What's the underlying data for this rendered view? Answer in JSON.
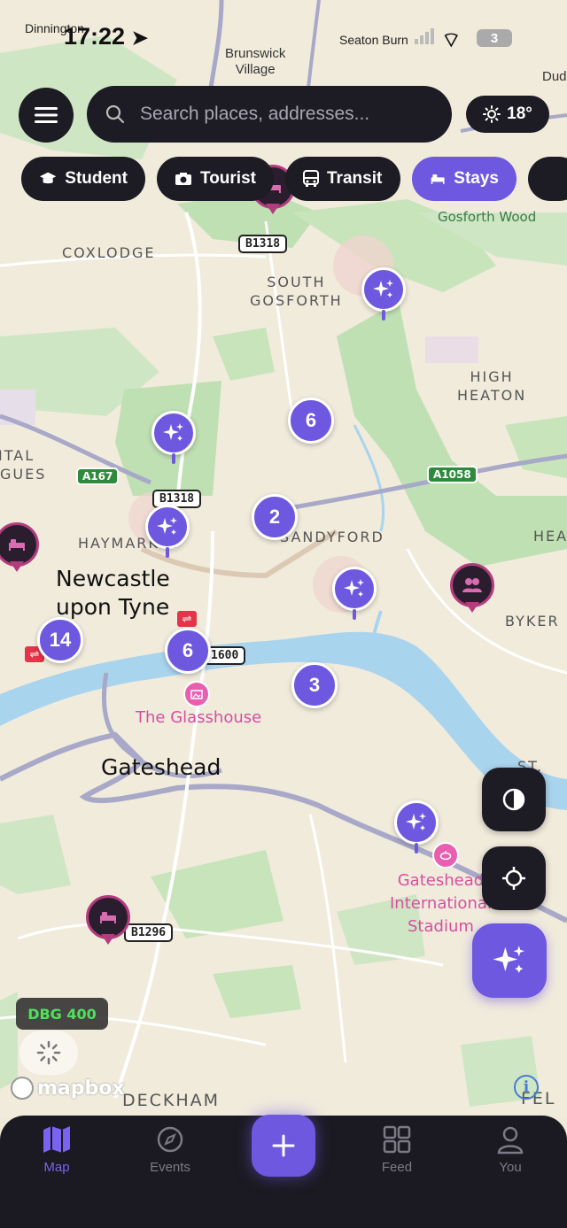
{
  "status_bar": {
    "time": "17:22",
    "carrier_area_left": "Dinnington",
    "carrier_area_right": "Seaton Burn",
    "battery": "3"
  },
  "search": {
    "placeholder": "Search places, addresses..."
  },
  "weather": {
    "temp": "18°"
  },
  "chips": [
    {
      "label": "Student",
      "icon": "graduation-cap-icon"
    },
    {
      "label": "Tourist",
      "icon": "camera-icon"
    },
    {
      "label": "Transit",
      "icon": "bus-icon"
    },
    {
      "label": "Stays",
      "icon": "bed-icon",
      "active": true
    }
  ],
  "map_labels": {
    "brunswick": "Brunswick\nVillage",
    "dud": "Dud",
    "gosforth_wood": "Gosforth Wood",
    "coxlodge": "COXLODGE",
    "south_gosforth": "SOUTH\nGOSFORTH",
    "high_heaton": "HIGH\nHEATON",
    "ital": "ITAL",
    "gues": "GUES",
    "haymarket": "HAYMARKET",
    "sandyford": "SANDYFORD",
    "hea": "HEA",
    "byker": "BYKER",
    "newcastle": "Newcastle\nupon Tyne",
    "glasshouse": "The Glasshouse",
    "gateshead": "Gateshead",
    "st": "ST.",
    "stadium": "Gateshead\nInternational\nStadium",
    "deckham": "DECKHAM",
    "fel": "FEL"
  },
  "road_shields": {
    "b1318_top": "B1318",
    "b1318_mid": "B1318",
    "a167": "A167",
    "a1058": "A1058",
    "a1600": "1600",
    "b1296": "B1296",
    "a167_low": "A167"
  },
  "clusters": {
    "c6_top": "6",
    "c2": "2",
    "c14": "14",
    "c6_mid": "6",
    "c3": "3"
  },
  "debug": {
    "label": "DBG 400"
  },
  "attribution": {
    "mapbox": "mapbox",
    "info": "i"
  },
  "tabbar": {
    "tabs": [
      {
        "label": "Map",
        "active": true
      },
      {
        "label": "Events"
      },
      {
        "label": "Feed"
      },
      {
        "label": "You"
      }
    ]
  },
  "colors": {
    "accent": "#6e58e0",
    "dark": "#1d1b24",
    "stay_ring": "#b33c7e",
    "poi_pink": "#d74fa0"
  }
}
